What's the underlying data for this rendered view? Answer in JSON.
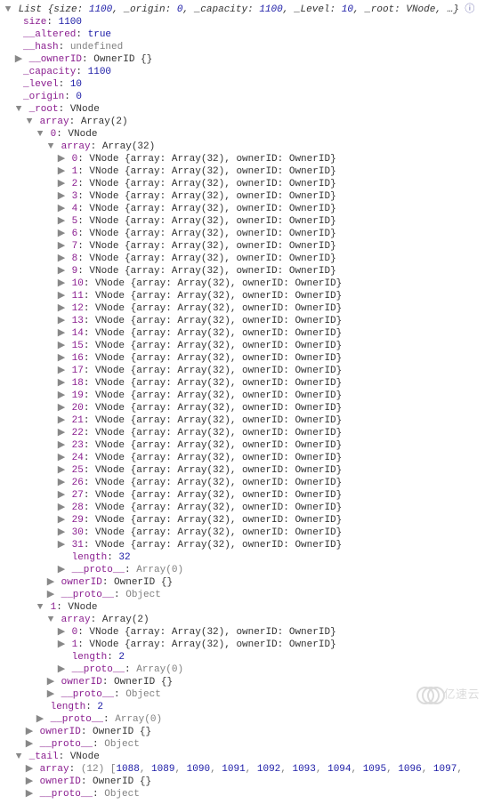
{
  "root_type": "List",
  "root_summary": {
    "size": 1100,
    "_origin": 0,
    "_capacity": 1100,
    "_Level": 10,
    "_root": "VNode",
    "tail": "…"
  },
  "info_glyph": "ⓘ",
  "header_fields": [
    {
      "key": "size",
      "val": "1100",
      "cls": "val-num"
    },
    {
      "key": "__altered",
      "val": "true",
      "cls": "val-bool"
    },
    {
      "key": "__hash",
      "val": "undefined",
      "cls": "val-undef"
    }
  ],
  "owner_line": {
    "key": "__ownerID",
    "val": "OwnerID {}"
  },
  "mid_fields": [
    {
      "key": "_capacity",
      "val": "1100",
      "cls": "val-num"
    },
    {
      "key": "_level",
      "val": "10",
      "cls": "val-num"
    },
    {
      "key": "_origin",
      "val": "0",
      "cls": "val-num"
    }
  ],
  "root_field": {
    "key": "_root",
    "val": "VNode"
  },
  "outer_array": {
    "key": "array",
    "val": "Array(2)"
  },
  "node0": {
    "key": "0",
    "val": "VNode"
  },
  "node0_array": {
    "key": "array",
    "val": "Array(32)"
  },
  "vnode_items": [
    {
      "i": 0
    },
    {
      "i": 1
    },
    {
      "i": 2
    },
    {
      "i": 3
    },
    {
      "i": 4
    },
    {
      "i": 5
    },
    {
      "i": 6
    },
    {
      "i": 7
    },
    {
      "i": 8
    },
    {
      "i": 9
    },
    {
      "i": 10
    },
    {
      "i": 11
    },
    {
      "i": 12
    },
    {
      "i": 13
    },
    {
      "i": 14
    },
    {
      "i": 15
    },
    {
      "i": 16
    },
    {
      "i": 17
    },
    {
      "i": 18
    },
    {
      "i": 19
    },
    {
      "i": 20
    },
    {
      "i": 21
    },
    {
      "i": 22
    },
    {
      "i": 23
    },
    {
      "i": 24
    },
    {
      "i": 25
    },
    {
      "i": 26
    },
    {
      "i": 27
    },
    {
      "i": 28
    },
    {
      "i": 29
    },
    {
      "i": 30
    },
    {
      "i": 31
    }
  ],
  "vnode_item_repr": "VNode {array: Array(32), ownerID: OwnerID}",
  "length32": {
    "key": "length",
    "val": "32"
  },
  "proto_arr0": {
    "key": "__proto__",
    "val": "Array(0)"
  },
  "ownerID_obj": {
    "key": "ownerID",
    "val": "OwnerID {}"
  },
  "proto_obj": {
    "key": "__proto__",
    "val": "Object"
  },
  "node1": {
    "key": "1",
    "val": "VNode"
  },
  "node1_array": {
    "key": "array",
    "val": "Array(2)"
  },
  "node1_items": [
    {
      "i": 0
    },
    {
      "i": 1
    }
  ],
  "node1_item_repr": "VNode {array: Array(32), ownerID: OwnerID}",
  "length2": {
    "key": "length",
    "val": "2"
  },
  "tail_field": {
    "key": "_tail",
    "val": "VNode"
  },
  "tail_array": {
    "key": "array",
    "prefix": "(12)",
    "values": [
      1088,
      1089,
      1090,
      1091,
      1092,
      1093,
      1094,
      1095,
      1096,
      1097
    ]
  },
  "watermark_text": "亿速云"
}
